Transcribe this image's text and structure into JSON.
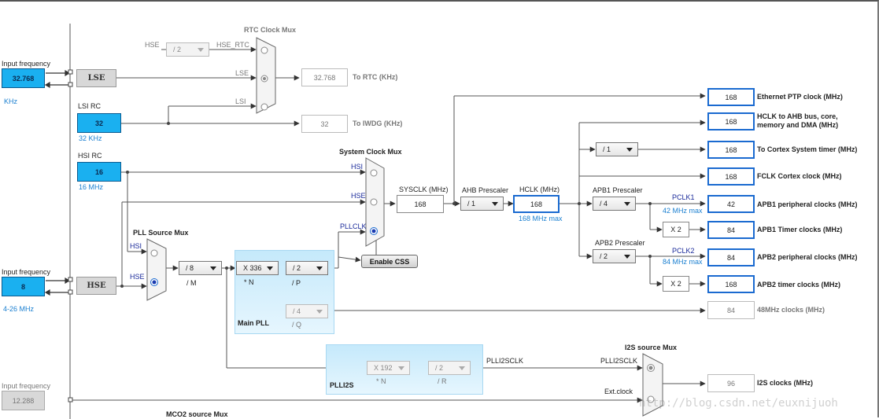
{
  "sources": {
    "lse": {
      "heading": "Input frequency",
      "value": "32.768",
      "unit": "KHz",
      "osc_label": "LSE"
    },
    "lsi": {
      "heading": "LSI RC",
      "value": "32",
      "freq": "32 KHz"
    },
    "hsi": {
      "heading": "HSI RC",
      "value": "16",
      "freq": "16 MHz"
    },
    "hse": {
      "heading": "Input frequency",
      "value": "8",
      "range": "4-26 MHz",
      "osc_label": "HSE"
    },
    "ext": {
      "heading": "Input frequency",
      "value": "12.288"
    }
  },
  "rtc": {
    "title": "RTC Clock Mux",
    "hse_label": "HSE",
    "hse_div": "/ 2",
    "hse_rtc_label": "HSE_RTC",
    "lse_label": "LSE",
    "lsi_label": "LSI",
    "to_rtc_value": "32.768",
    "to_rtc_label": "To RTC (KHz)",
    "to_iwdg_value": "32",
    "to_iwdg_label": "To IWDG (KHz)"
  },
  "pll": {
    "src_title": "PLL Source Mux",
    "src_hsi": "HSI",
    "src_hse": "HSE",
    "m_div": "/ 8",
    "m_label": "/ M",
    "n_mul": "X 336",
    "n_label": "* N",
    "p_div": "/ 2",
    "p_label": "/ P",
    "q_div": "/ 4",
    "q_label": "/ Q",
    "box_title": "Main PLL"
  },
  "sysmux": {
    "title": "System Clock Mux",
    "hsi": "HSI",
    "hse": "HSE",
    "pllclk": "PLLCLK",
    "enable_css": "Enable CSS"
  },
  "bus": {
    "sysclk_label": "SYSCLK (MHz)",
    "sysclk_value": "168",
    "ahb_label": "AHB Prescaler",
    "ahb_div": "/ 1",
    "hclk_label": "HCLK (MHz)",
    "hclk_value": "168",
    "hclk_max": "168 MHz max",
    "cortex_div": "/ 1",
    "apb1_label": "APB1 Prescaler",
    "apb1_div": "/ 4",
    "pclk1_label": "PCLK1",
    "pclk1_max": "42 MHz max",
    "apb1_timer_mul": "X 2",
    "apb2_label": "APB2 Prescaler",
    "apb2_div": "/ 2",
    "pclk2_label": "PCLK2",
    "pclk2_max": "84 MHz max",
    "apb2_timer_mul": "X 2"
  },
  "outputs": [
    {
      "value": "168",
      "label": "Ethernet PTP clock (MHz)"
    },
    {
      "value": "168",
      "label": "HCLK to AHB bus, core,",
      "label2": "memory and DMA (MHz)"
    },
    {
      "value": "168",
      "label": "To Cortex System timer (MHz)"
    },
    {
      "value": "168",
      "label": "FCLK Cortex clock (MHz)"
    },
    {
      "value": "42",
      "label": "APB1 peripheral clocks (MHz)"
    },
    {
      "value": "84",
      "label": "APB1 Timer clocks (MHz)"
    },
    {
      "value": "84",
      "label": "APB2 peripheral clocks (MHz)"
    },
    {
      "value": "168",
      "label": "APB2 timer clocks (MHz)"
    },
    {
      "value": "84",
      "label": "48MHz clocks (MHz)"
    },
    {
      "value": "96",
      "label": "I2S clocks (MHz)"
    }
  ],
  "plli2s": {
    "title": "PLLI2S",
    "n_mul": "X 192",
    "n_label": "* N",
    "r_div": "/ 2",
    "r_label": "/ R",
    "out_label": "PLLI2SCLK"
  },
  "i2smux": {
    "title": "I2S source Mux",
    "in1": "PLLI2SCLK",
    "in2": "Ext.clock"
  },
  "mco2_title": "MCO2 source Mux",
  "watermark": "http://blog.csdn.net/euxnijuoh"
}
